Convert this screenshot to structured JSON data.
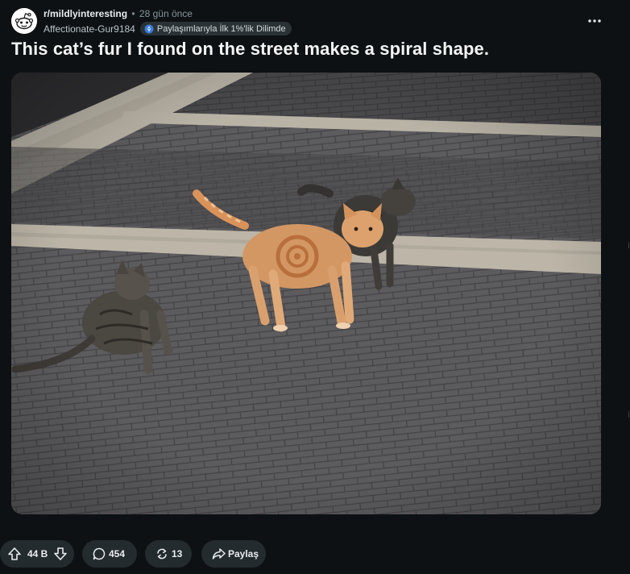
{
  "post": {
    "subreddit": "r/mildlyinteresting",
    "separator": "•",
    "time_ago": "28 gün önce",
    "author": "Affectionate-Gur9184",
    "flair": "Paylaşımlarıyla İlk 1%'lik Dilimde",
    "title": "This cat’s fur I found on the street makes a spiral shape.",
    "image_description_icon": "photo-of-cats-on-brick-street"
  },
  "actions": {
    "votes": "44 B",
    "comments": "454",
    "crossposts": "13",
    "share_label": "Paylaş"
  },
  "icons": {
    "more": "more-horizontal-icon",
    "upvote": "arrow-up-icon",
    "downvote": "arrow-down-icon",
    "comment": "comment-bubble-icon",
    "crosspost": "crosspost-icon",
    "share": "share-arrow-icon",
    "flair": "rocket-icon"
  },
  "colors": {
    "background": "#0e1113",
    "pill": "#242b2e",
    "flair_bg": "#2a3236",
    "muted_text": "#82959b"
  }
}
